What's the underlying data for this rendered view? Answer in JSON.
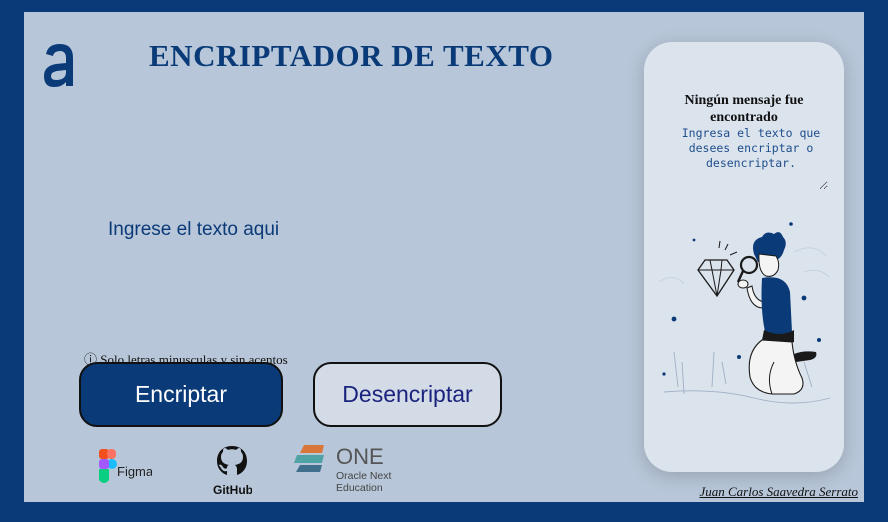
{
  "header": {
    "logo_icon": "alura-a-logo-icon",
    "title": "ENCRIPTADOR DE TEXTO"
  },
  "input": {
    "placeholder": "Ingrese el texto aqui"
  },
  "hint": {
    "icon": "info-icon",
    "text": "ⓘ Solo letras minusculas y sin acentos"
  },
  "buttons": {
    "encrypt_label": "Encriptar",
    "decrypt_label": "Desencriptar"
  },
  "brands": {
    "figma_label": "Figma",
    "github_label": "GitHub",
    "one_label": "ONE",
    "one_sub_line1": "Oracle Next",
    "one_sub_line2": "Education"
  },
  "output": {
    "title": "Ningún mensaje fue encontrado",
    "placeholder": "Ingresa el texto que desees encriptar o desencriptar.",
    "illustration_icon": "person-with-magnifier-illustration"
  },
  "footer": {
    "author": "Juan Carlos Saavedra Serrato"
  },
  "colors": {
    "brand_dark": "#0a3a78",
    "background": "#b7c6d8",
    "panel": "#dbe3ed"
  }
}
